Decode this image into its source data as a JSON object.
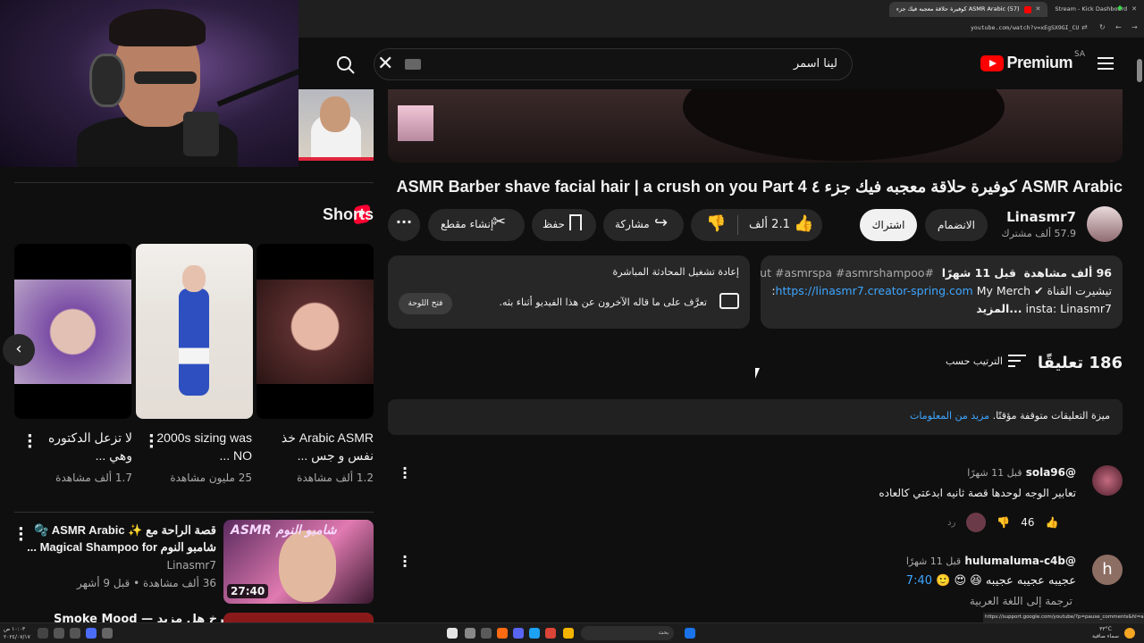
{
  "browser": {
    "tabs": [
      {
        "label": "Stream - Kick Dashboard",
        "favicon_color": "#53fc18",
        "active": false
      },
      {
        "label": "(57) ASMR Arabic كوفيرة حلاقة معجبه فيك جزء",
        "favicon_color": "#ff0000",
        "active": true
      }
    ],
    "url": "youtube.com/watch?v=xEgSX9GI_CU",
    "status_url": "https://support.google.com/youtube/?p=pause_comments&hl=ar"
  },
  "header": {
    "logo_text": "Premium",
    "region": "SA",
    "search_value": "لينا اسمر"
  },
  "sidebar": {
    "shorts_heading": "Shorts",
    "shorts": [
      {
        "title": "Arabic ASMR خذ نفس و جس ...",
        "views": "1.2 ألف مشاهدة",
        "colors": [
          "#d8a7a0",
          "#7a4040"
        ]
      },
      {
        "title": "2000s sizing was NO ...",
        "views": "25 مليون مشاهدة",
        "colors": [
          "#e9e5e1",
          "#2c4fb8"
        ]
      },
      {
        "title": "لا تزعل الدكتوره وهي ...",
        "views": "1.7 ألف مشاهدة",
        "colors": [
          "#d4b5c6",
          "#7b4fa8"
        ]
      }
    ],
    "rec": {
      "title": "قصة الراحة مع ✨ ASMR Arabic 🫧 شامبو النوم Magical Shampoo for ...",
      "channel": "Linasmr7",
      "meta": "36 ألف مشاهدة • قبل 9 أشهر",
      "duration": "27:40",
      "thumb_label": "ASMR شامبو النوم"
    },
    "rec2_title": "فقط استرخ هل مزيد — Smoke Mood"
  },
  "video": {
    "title": "ASMR Arabic كوفيرة حلاقة معجبه فيك جزء ٤ ASMR Barber shave facial hair | a crush on you Part 4",
    "channel_name": "Linasmr7",
    "subscribers": "57.9 ألف مشترك",
    "join_label": "الانضمام",
    "subscribe_label": "اشتراك",
    "like_count": "2.1 ألف",
    "share_label": "مشاركة",
    "save_label": "حفظ",
    "clip_label": "إنشاء مقطع"
  },
  "description": {
    "views": "96 ألف مشاهدة",
    "time": "قبل 11 شهرًا",
    "tags": "#asmrhaircut #asmrspa #asmrshampoo",
    "merch_prefix": "تيشيرت القناة",
    "merch_label": "My Merch:",
    "merch_link": "https://linasmr7.creator-spring.com",
    "more": "...المزيد",
    "insta": "insta: Linasmr7"
  },
  "live_chat": {
    "title": "إعادة تشغيل المحادثة المباشرة",
    "desc": "تعرَّف على ما قاله الآخرون عن هذا الفيديو أثناء بثه.",
    "open_label": "فتح اللوحة"
  },
  "comments": {
    "count": "186 تعليقًا",
    "sort_label": "الترتيب حسب",
    "paused_text": "ميزة التعليقات متوقفة مؤقتًا.",
    "paused_link": "مزيد من المعلومات",
    "items": [
      {
        "author": "@sola96",
        "time": "قبل 11 شهرًا",
        "text": "تعابير الوجه لوحدها قصة ثانيه ابدعتي كالعاده",
        "likes": "46",
        "reply": "رد",
        "avatar_color": "#8a3a52"
      },
      {
        "author": "@hulumaluma-c4b",
        "time": "قبل 11 شهرًا",
        "text": "عجيبه عجيبه عجيبه 😆 😍 🙂",
        "timestamp": "7:40",
        "avatar_letter": "h",
        "avatar_color": "#8d6e63"
      }
    ],
    "translate_label": "ترجمة إلى اللغة العربية"
  },
  "taskbar": {
    "search_placeholder": "بحث",
    "time": "١٠:٠٣ ص",
    "date": "٢٠٢٤/٠٧/١٧",
    "weather_temp": "٣٣°C",
    "weather_desc": "سماء صافية"
  }
}
